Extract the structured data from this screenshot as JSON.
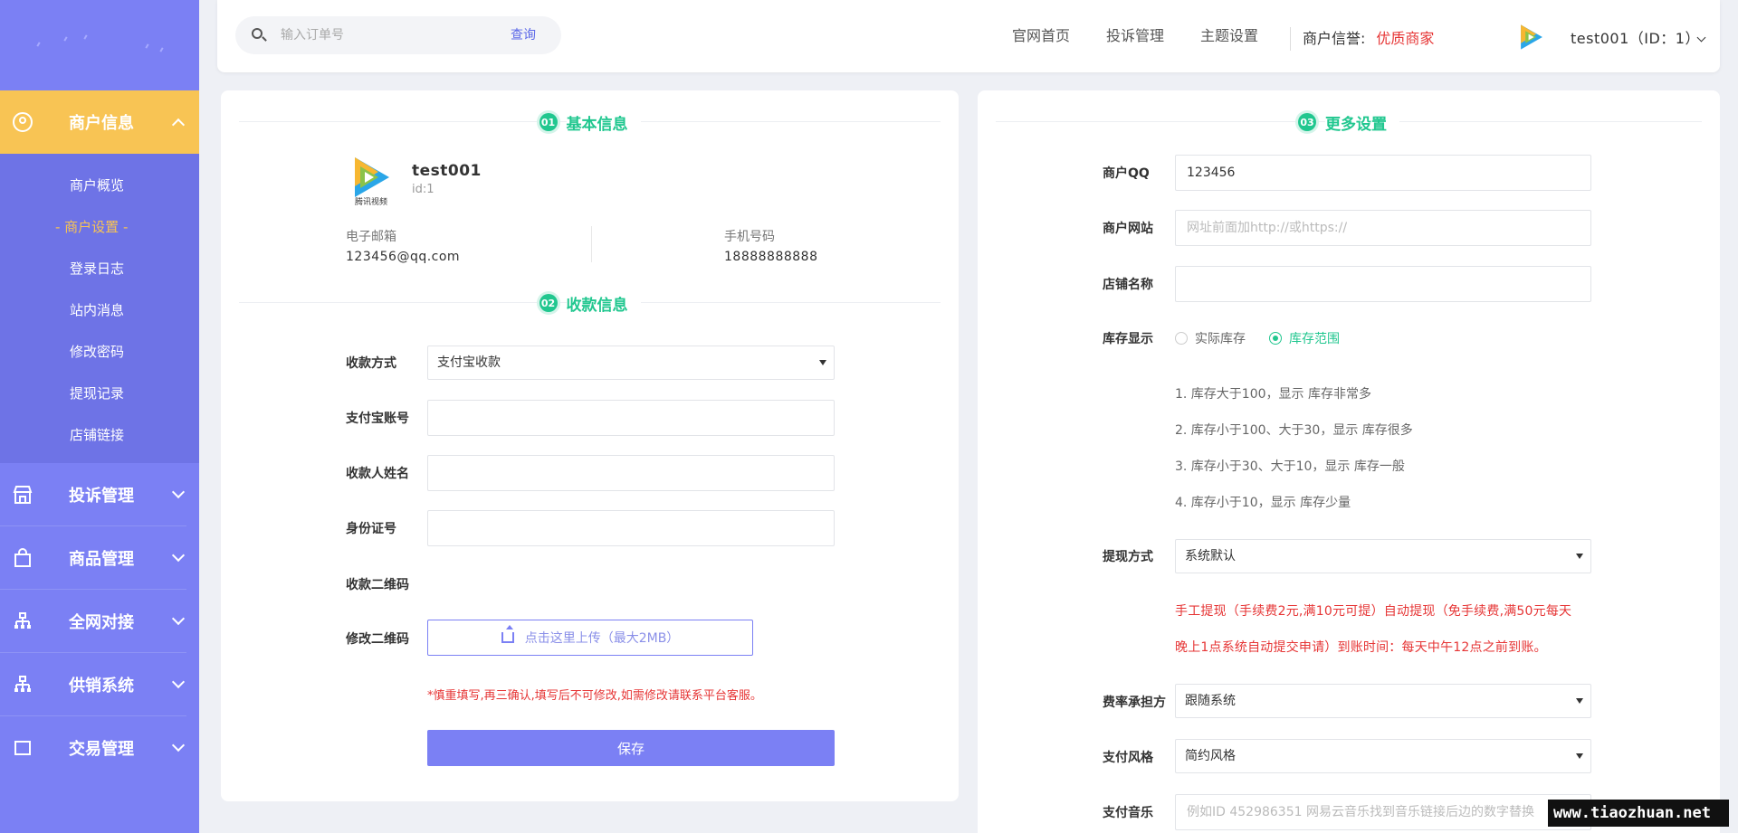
{
  "sidebar": {
    "active_group": "商户信息",
    "sub_items": [
      "商户概览",
      "商户设置",
      "登录日志",
      "站内消息",
      "修改密码",
      "提现记录",
      "店铺链接"
    ],
    "active_sub": "- 商户设置 -",
    "menus": [
      "投诉管理",
      "商品管理",
      "全网对接",
      "供销系统",
      "交易管理"
    ]
  },
  "header": {
    "search_placeholder": "输入订单号",
    "search_button": "查询",
    "nav": [
      "官网首页",
      "投诉管理",
      "主题设置"
    ],
    "credit_label": "商户信誉:",
    "credit_value": "优质商家",
    "user": "test001（ID：1）"
  },
  "basic": {
    "section_num": "01",
    "section_title": "基本信息",
    "logo_text": "腾讯视频",
    "name": "test001",
    "id": "id:1",
    "email_label": "电子邮箱",
    "email": "123456@qq.com",
    "phone_label": "手机号码",
    "phone": "18888888888"
  },
  "payee": {
    "section_num": "02",
    "section_title": "收款信息",
    "method_label": "收款方式",
    "method_value": "支付宝收款",
    "account_label": "支付宝账号",
    "name_label": "收款人姓名",
    "idcard_label": "身份证号",
    "qr_label": "收款二维码",
    "edit_qr_label": "修改二维码",
    "upload_text": "点击这里上传（最大2MB）",
    "warning": "*慎重填写,再三确认,填写后不可修改,如需修改请联系平台客服。",
    "save": "保存"
  },
  "more": {
    "section_num": "03",
    "section_title": "更多设置",
    "qq_label": "商户QQ",
    "qq_value": "123456",
    "site_label": "商户网站",
    "site_placeholder": "网址前面加http://或https://",
    "shop_label": "店铺名称",
    "stock_label": "库存显示",
    "stock_opt1": "实际库存",
    "stock_opt2": "库存范围",
    "stock_notes": [
      "1. 库存大于100，显示 库存非常多",
      "2. 库存小于100、大于30，显示 库存很多",
      "3. 库存小于30、大于10，显示 库存一般",
      "4. 库存小于10，显示 库存少量"
    ],
    "withdraw_label": "提现方式",
    "withdraw_value": "系统默认",
    "withdraw_note1": "手工提现（手续费2元,满10元可提）自动提现（免手续费,满50元每天",
    "withdraw_note2": "晚上1点系统自动提交申请）到账时间：每天中午12点之前到账。",
    "fee_label": "费率承担方",
    "fee_value": "跟随系统",
    "style_label": "支付风格",
    "style_value": "简约风格",
    "music_label": "支付音乐",
    "music_placeholder": "例如ID 452986351 网易云音乐找到音乐链接后边的数字替换"
  },
  "watermark": "www.tiaozhuan.net",
  "colors": {
    "sidebar": "#7b80f4",
    "active": "#f8c454",
    "green": "#21c78f",
    "red": "#e63535"
  }
}
